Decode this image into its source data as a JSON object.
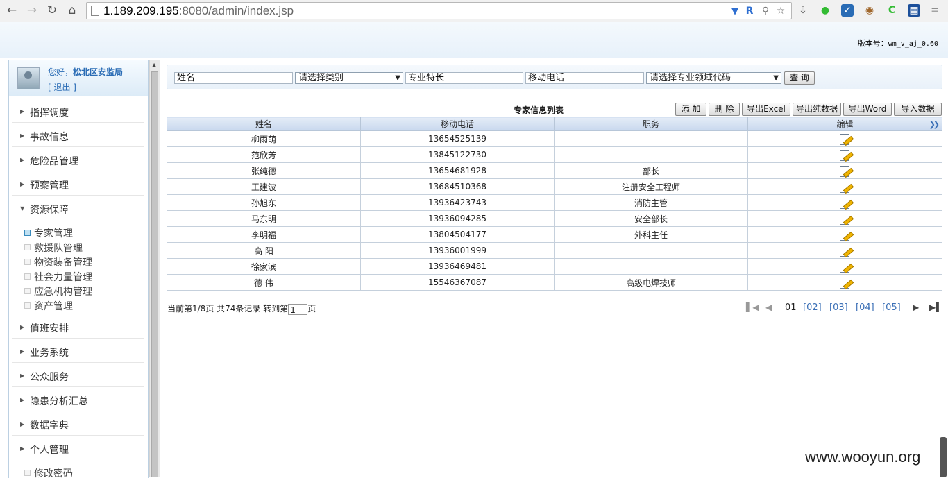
{
  "browser": {
    "url_host": "1.189.209.195",
    "url_rest": ":8080/admin/index.jsp",
    "icons": [
      "back-icon",
      "forward-icon",
      "reload-icon",
      "home-icon",
      "page-icon",
      "shield-icon",
      "translate-icon",
      "key-icon",
      "star-icon",
      "download-icon",
      "record-icon",
      "weibo-icon",
      "cookie-icon",
      "c-icon",
      "chart-ext-icon"
    ]
  },
  "header": {
    "version_label": "版本号：",
    "version_value": "wm_v_aj_0.60"
  },
  "sidebar": {
    "greeting": "您好，",
    "user": "松北区安监局",
    "logout": "[ 退出 ]",
    "menu": [
      {
        "label": "指挥调度"
      },
      {
        "label": "事故信息"
      },
      {
        "label": "危险品管理"
      },
      {
        "label": "预案管理"
      },
      {
        "label": "资源保障"
      },
      {
        "label": "值班安排"
      },
      {
        "label": "业务系统"
      },
      {
        "label": "公众服务"
      },
      {
        "label": "隐患分析汇总"
      },
      {
        "label": "数据字典"
      },
      {
        "label": "个人管理"
      }
    ],
    "resource_sub": [
      "专家管理",
      "救援队管理",
      "物资装备管理",
      "社会力量管理",
      "应急机构管理",
      "资产管理"
    ],
    "personal_sub": [
      "修改密码"
    ]
  },
  "search": {
    "name_value": "姓名",
    "category_value": "请选择类别",
    "specialty_value": "专业特长",
    "phone_value": "移动电话",
    "domain_value": "请选择专业领域代码",
    "query_label": "查 询"
  },
  "toolbar": {
    "title": "专家信息列表",
    "add": "添 加",
    "delete": "删 除",
    "export_excel": "导出Excel",
    "export_pure": "导出纯数据",
    "export_word": "导出Word",
    "import": "导入数据"
  },
  "table": {
    "columns": [
      "姓名",
      "移动电话",
      "职务",
      "编辑"
    ],
    "rows": [
      {
        "name": "柳雨萌",
        "phone": "13654525139",
        "title": ""
      },
      {
        "name": "范欣芳",
        "phone": "13845122730",
        "title": ""
      },
      {
        "name": "张纯德",
        "phone": "13654681928",
        "title": "部长"
      },
      {
        "name": "王建波",
        "phone": "13684510368",
        "title": "注册安全工程师"
      },
      {
        "name": "孙旭东",
        "phone": "13936423743",
        "title": "消防主管"
      },
      {
        "name": "马东明",
        "phone": "13936094285",
        "title": "安全部长"
      },
      {
        "name": "李明福",
        "phone": "13804504177",
        "title": "外科主任"
      },
      {
        "name": "高 阳",
        "phone": "13936001999",
        "title": ""
      },
      {
        "name": "徐家滨",
        "phone": "13936469481",
        "title": ""
      },
      {
        "name": "德 伟",
        "phone": "15546367087",
        "title": "高级电焊技师"
      }
    ]
  },
  "pager": {
    "info": "当前第1/8页 共74条记录 转到第",
    "page_input": "1",
    "suffix": "页",
    "current": "01",
    "links": [
      "[02]",
      "[03]",
      "[04]",
      "[05]"
    ]
  },
  "watermark": "www.wooyun.org"
}
